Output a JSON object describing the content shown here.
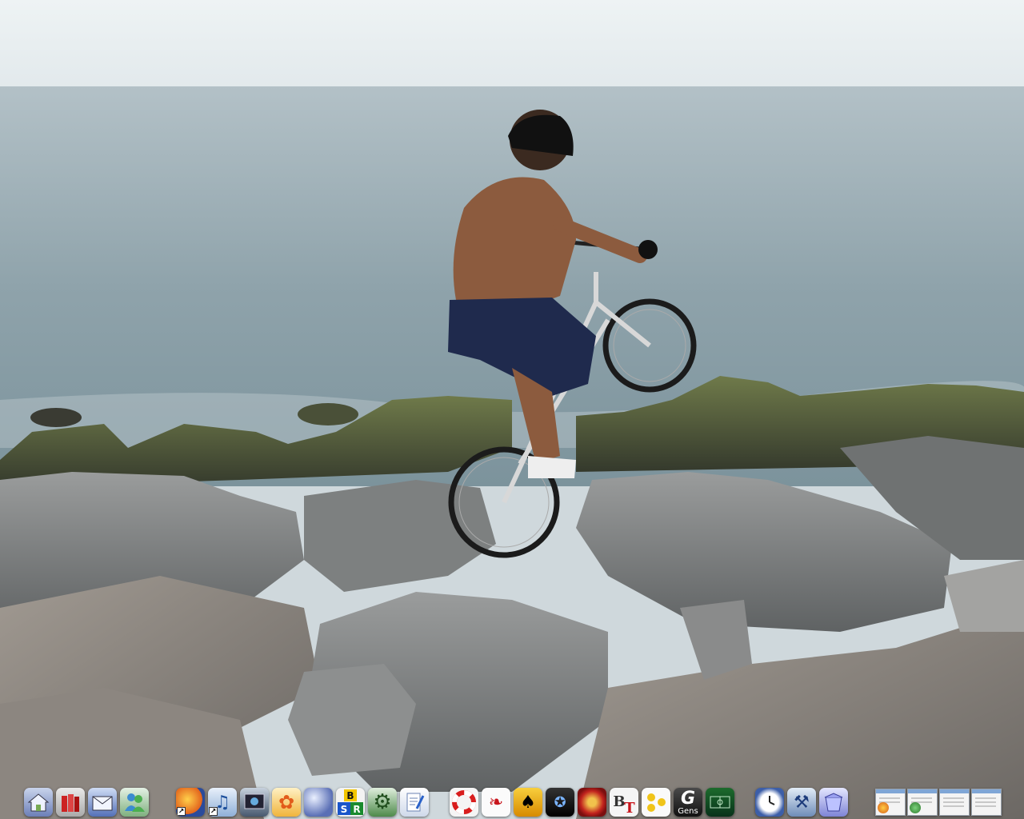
{
  "desktop": {
    "wallpaper": {
      "sky_color": "#e9eef0",
      "sea_color": "#8fa6b0",
      "rock_color": "#7d7f80"
    }
  },
  "dock": {
    "groups": [
      {
        "name": "system",
        "icons": [
          {
            "name": "home-folder-icon",
            "label": ""
          },
          {
            "name": "books-icon",
            "label": ""
          },
          {
            "name": "mail-box-icon",
            "label": ""
          },
          {
            "name": "messenger-buddies-icon",
            "label": ""
          }
        ]
      },
      {
        "name": "apps",
        "icons": [
          {
            "name": "firefox-icon",
            "label": ""
          },
          {
            "name": "itunes-icon",
            "label": ""
          },
          {
            "name": "media-center-icon",
            "label": ""
          },
          {
            "name": "flower-app-icon",
            "label": ""
          },
          {
            "name": "moon-app-icon",
            "label": ""
          },
          {
            "name": "bsr-icon",
            "letters": [
              "B",
              "S",
              "R"
            ]
          },
          {
            "name": "gear-settings-icon",
            "label": ""
          },
          {
            "name": "notepad-icon",
            "label": ""
          }
        ]
      },
      {
        "name": "tools",
        "icons": [
          {
            "name": "lifebuoy-icon",
            "label": ""
          },
          {
            "name": "acrobat-icon",
            "label": ""
          },
          {
            "name": "solitaire-icon",
            "label": ""
          },
          {
            "name": "logo-app-icon",
            "label": ""
          },
          {
            "name": "red-disc-icon",
            "label": ""
          },
          {
            "name": "bittorrent-icon",
            "letters": [
              "B",
              "T"
            ]
          },
          {
            "name": "dots-app-icon",
            "label": ""
          },
          {
            "name": "gens-icon",
            "label": "G",
            "caption": "Gens"
          },
          {
            "name": "football-manager-icon",
            "label": ""
          }
        ]
      },
      {
        "name": "utilities",
        "icons": [
          {
            "name": "clock-icon",
            "label": ""
          },
          {
            "name": "tools-icon",
            "label": ""
          },
          {
            "name": "recycle-bin-icon",
            "label": ""
          }
        ]
      },
      {
        "name": "windows",
        "thumbs": [
          {
            "name": "window-thumb-firefox"
          },
          {
            "name": "window-thumb-messenger"
          },
          {
            "name": "window-thumb-explorer"
          },
          {
            "name": "window-thumb-document"
          }
        ]
      }
    ]
  }
}
